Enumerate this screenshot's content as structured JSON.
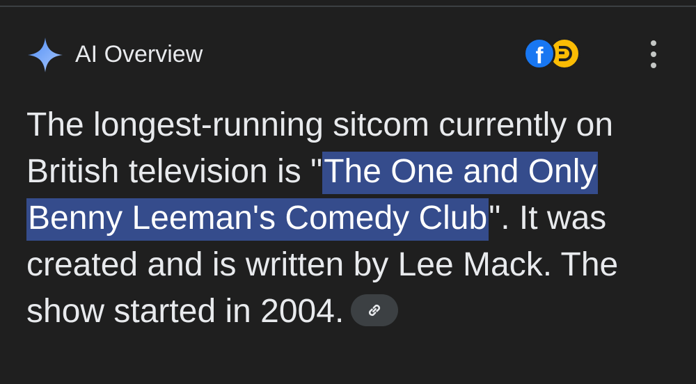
{
  "header": {
    "title": "AI Overview",
    "spark_icon": "gemini-spark-icon",
    "menu_icon": "more-vert-icon"
  },
  "sources": [
    {
      "name": "facebook",
      "glyph": "f",
      "color": "#1877f2"
    },
    {
      "name": "source-yellow",
      "color": "#fbbc04"
    }
  ],
  "answer": {
    "line1": "The longest-running sitcom currently on",
    "line2_pre": "British television is \"",
    "line2_hl": "The One and Only",
    "line3_hl": "Benny Leeman's Comedy Club",
    "line3_post": "\". It was",
    "line4": "created and is written by Lee Mack. The",
    "line5": "show started in 2004.",
    "link_icon": "link-icon"
  },
  "colors": {
    "background": "#1f1f1f",
    "text": "#e8eaed",
    "highlight": "#354c8c",
    "chip": "#3c4043"
  }
}
